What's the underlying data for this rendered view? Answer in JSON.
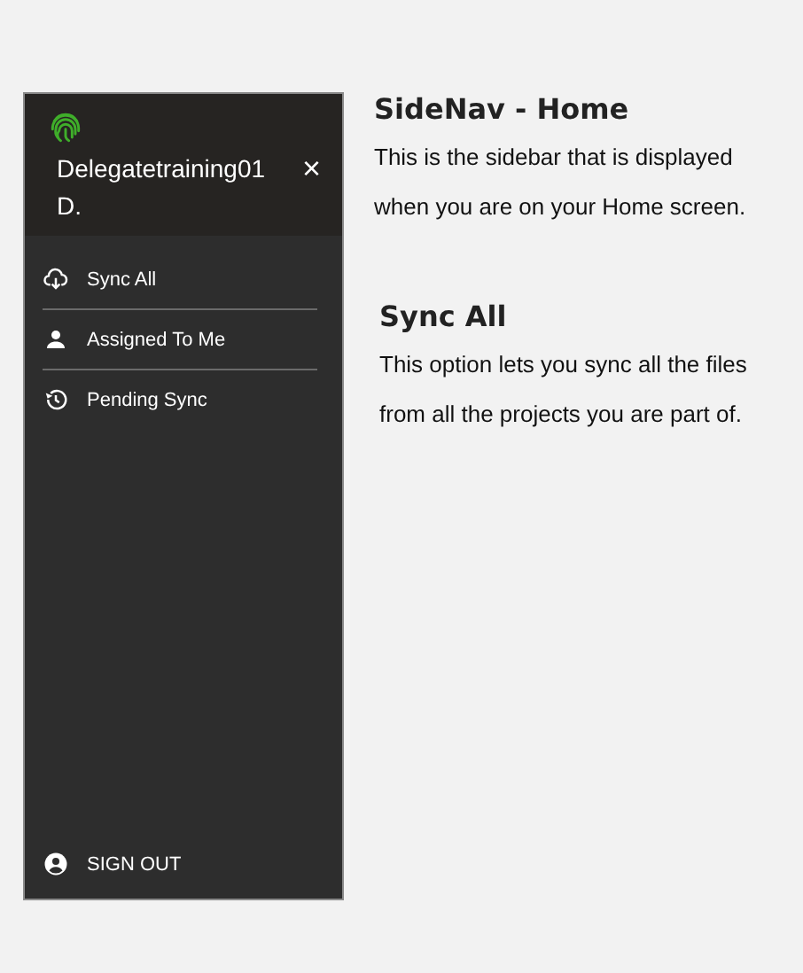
{
  "sidenav": {
    "user_name": "Delegatetraining01 D.",
    "close": "×",
    "items": [
      {
        "label": "Sync All",
        "kind": "cloud"
      },
      {
        "label": "Assigned To Me",
        "kind": "person"
      },
      {
        "label": "Pending Sync",
        "kind": "history"
      }
    ],
    "sign_out": "SIGN OUT"
  },
  "notes": [
    {
      "title": "SideNav - Home",
      "body_lines": [
        "This is the sidebar that is displayed",
        "when you are on your Home screen."
      ]
    },
    {
      "title": "Sync All",
      "body_lines": [
        "This option lets you sync all the files",
        "from all the projects you are part of."
      ]
    }
  ]
}
